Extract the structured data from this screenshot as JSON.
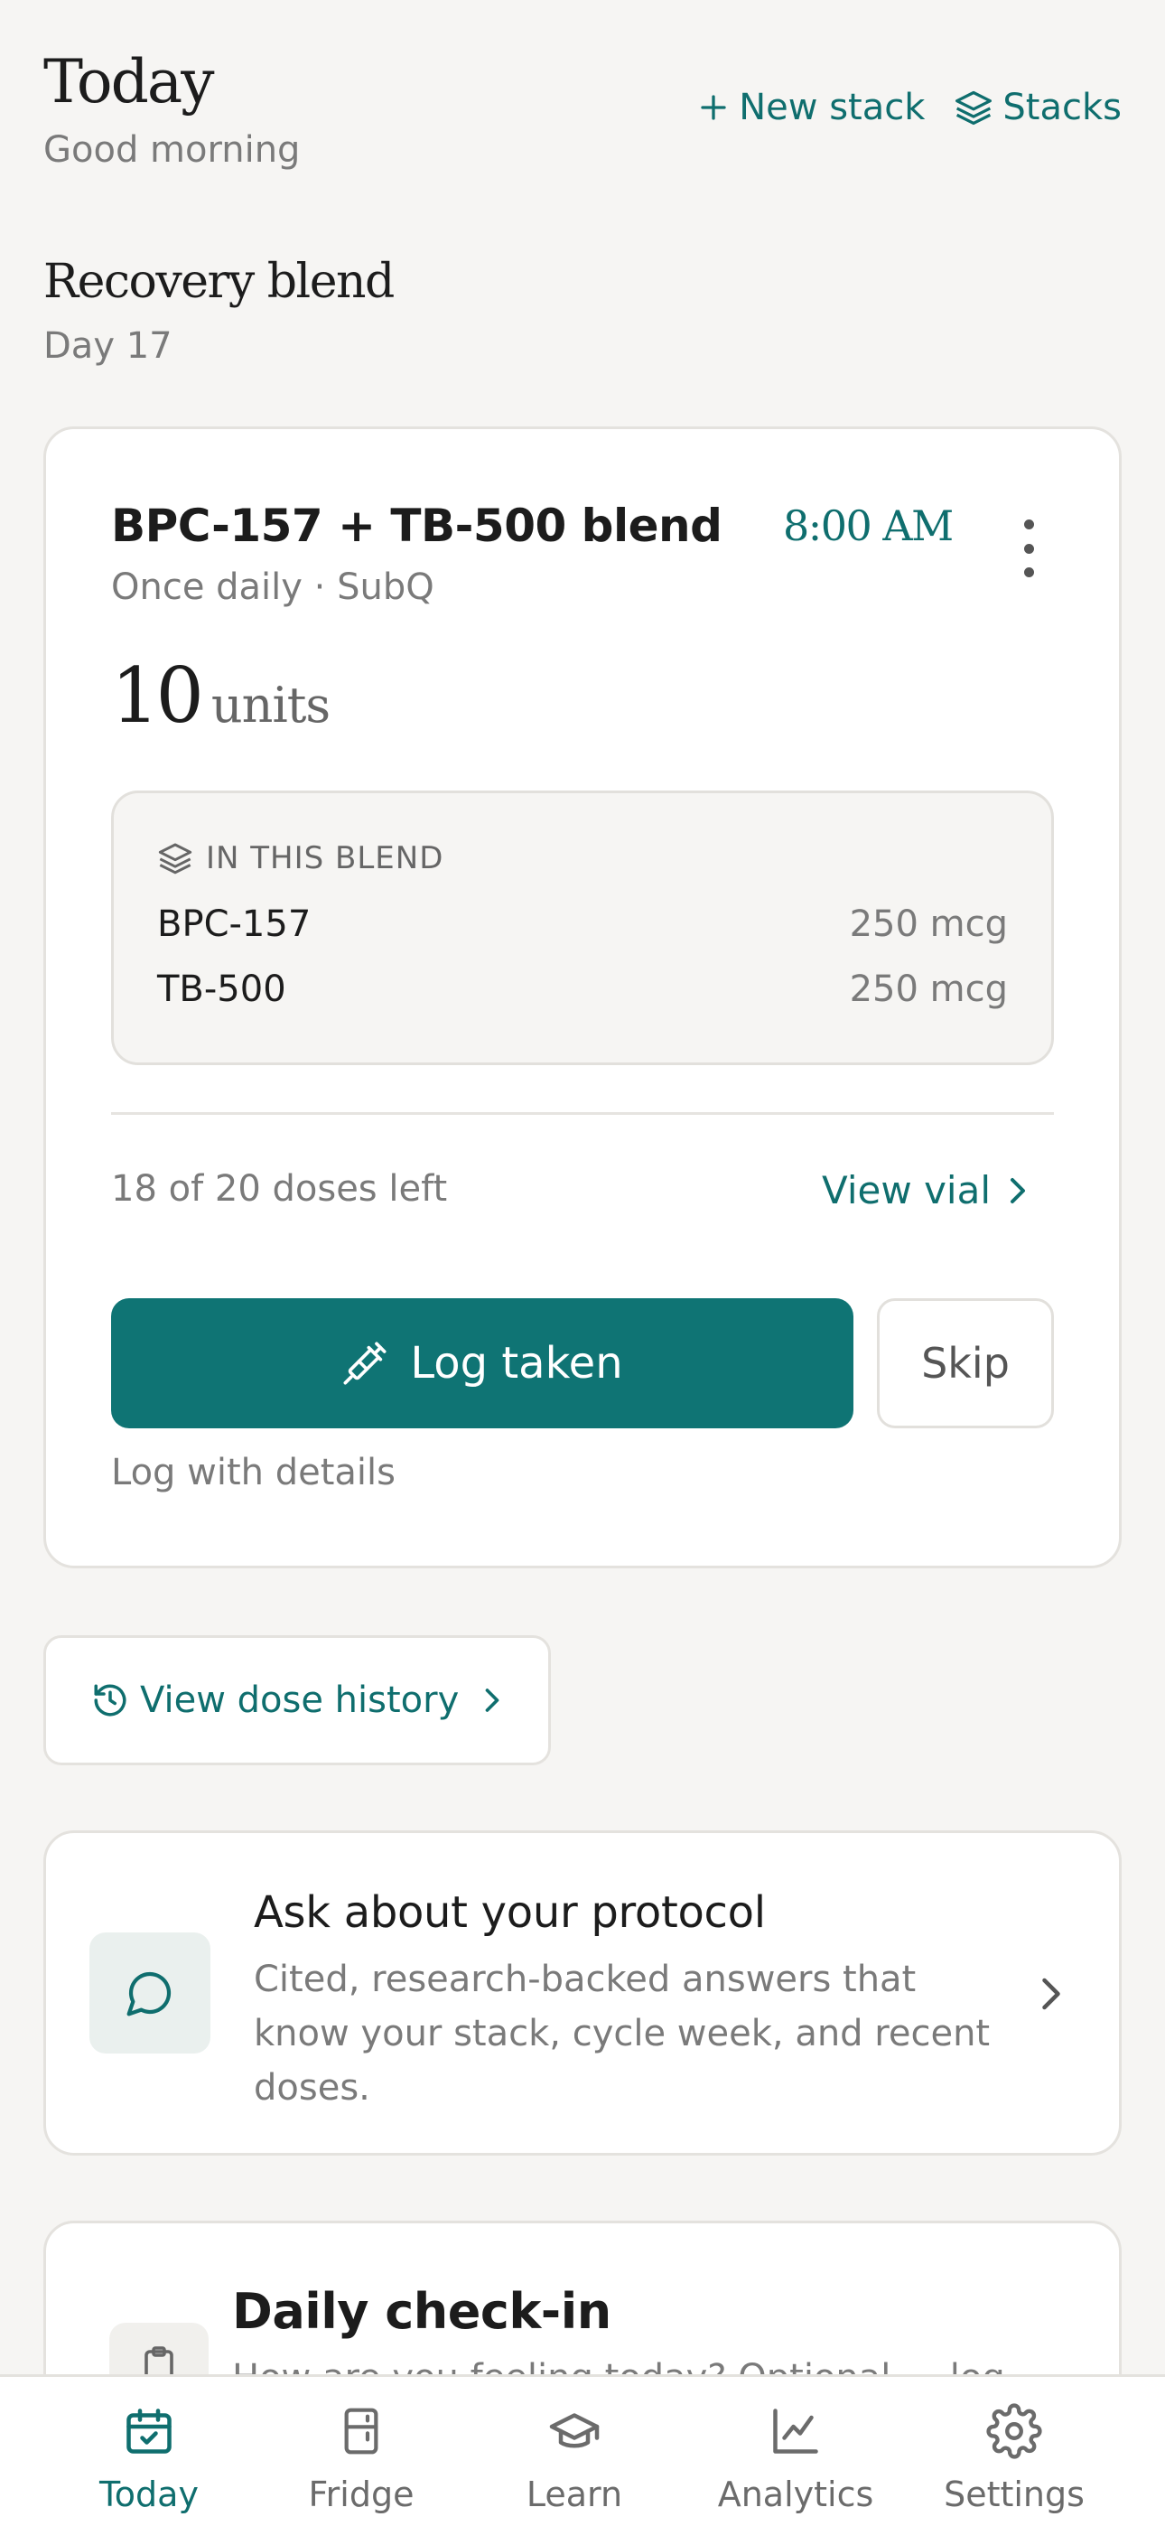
{
  "header": {
    "title": "Today",
    "greeting": "Good morning",
    "new_stack_label": "New stack",
    "stacks_label": "Stacks"
  },
  "stack": {
    "name": "Recovery blend",
    "day": "Day 17"
  },
  "dose": {
    "name": "BPC-157 + TB-500 blend",
    "time": "8:00 AM",
    "schedule": "Once daily · SubQ",
    "amount": "10",
    "unit": "units",
    "blend_label": "IN THIS BLEND",
    "components": [
      {
        "name": "BPC-157",
        "qty": "250 mcg"
      },
      {
        "name": "TB-500",
        "qty": "250 mcg"
      }
    ],
    "remaining": "18 of 20 doses left",
    "view_vial_label": "View vial",
    "log_taken_label": "Log taken",
    "skip_label": "Skip",
    "log_details_label": "Log with details"
  },
  "history": {
    "label": "View dose history"
  },
  "ask": {
    "title": "Ask about your protocol",
    "description": "Cited, research-backed answers that know your stack, cycle week, and recent doses."
  },
  "checkin": {
    "title": "Daily check-in",
    "description": "How are you feeling today? Optional — log"
  },
  "nav": {
    "items": [
      {
        "label": "Today",
        "icon": "calendar-check-icon",
        "active": true
      },
      {
        "label": "Fridge",
        "icon": "fridge-icon",
        "active": false
      },
      {
        "label": "Learn",
        "icon": "graduation-cap-icon",
        "active": false
      },
      {
        "label": "Analytics",
        "icon": "line-chart-icon",
        "active": false
      },
      {
        "label": "Settings",
        "icon": "gear-icon",
        "active": false
      }
    ]
  },
  "colors": {
    "accent": "#0f6e6e",
    "primary_button": "#0f7474",
    "background": "#f6f5f3"
  }
}
